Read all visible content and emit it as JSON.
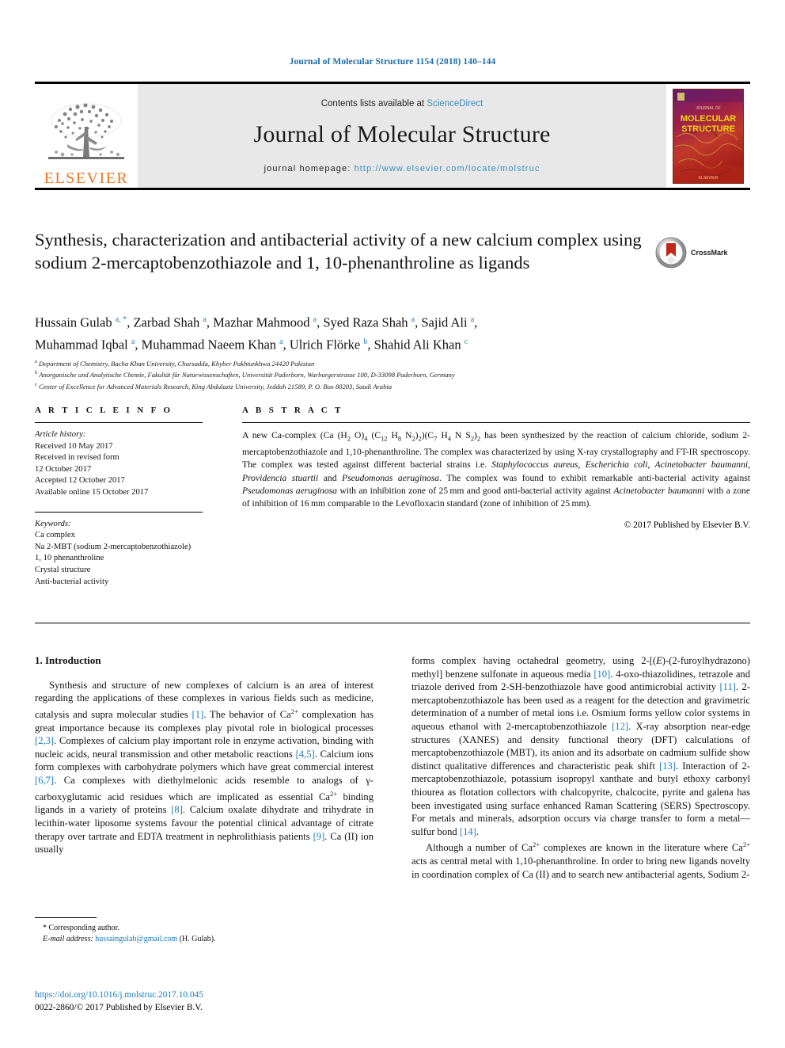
{
  "running_head": "Journal of Molecular Structure 1154 (2018) 140–144",
  "masthead": {
    "contents_prefix": "Contents lists available at ",
    "sciencedirect": "ScienceDirect",
    "journal_name": "Journal of Molecular Structure",
    "homepage_prefix": "journal homepage: ",
    "homepage_url": "http://www.elsevier.com/locate/molstruc",
    "publisher_wordmark": "ELSEVIER",
    "publisher_color": "#E87722",
    "link_color": "#3a8fbf",
    "cover_title_line1": "MOLECULAR",
    "cover_title_line2": "STRUCTURE"
  },
  "crossmark": {
    "label": "CrossMark"
  },
  "article": {
    "title": "Synthesis, characterization and antibacterial activity of a new calcium complex using sodium 2-mercaptobenzothiazole and 1, 10-phenanthroline as ligands",
    "authors_line1": "Hussain Gulab <sup>a, *</sup>, Zarbad Shah <sup>a</sup>, Mazhar Mahmood <sup>a</sup>, Syed Raza Shah <sup>a</sup>, Sajid Ali <sup>a</sup>,",
    "authors_line2": "Muhammad Iqbal <sup>a</sup>, Muhammad Naeem Khan <sup>a</sup>, Ulrich Flörke <sup>b</sup>, Shahid Ali Khan <sup>c</sup>",
    "affiliations": [
      "Department of Chemistry, Bacha Khan University, Charsadda, Khyber Pakhtunkhwa 24420 Pakistan",
      "Anorganische und Analytische Chemie, Fakultät für Naturwissenschaften, Universität Paderborn, Warburgerstrasse 100, D-33098 Paderborn, Germany",
      "Center of Excellence for Advanced Materials Research, King Abdulaziz University, Jeddah 21589, P. O. Box 80203, Saudi Arabia"
    ],
    "affiliation_marks": [
      "a",
      "b",
      "c"
    ]
  },
  "article_info": {
    "heading": "A R T I C L E   I N F O",
    "history_label": "Article history:",
    "history": [
      "Received 10 May 2017",
      "Received in revised form",
      "12 October 2017",
      "Accepted 12 October 2017",
      "Available online 15 October 2017"
    ],
    "keywords_label": "Keywords:",
    "keywords": [
      "Ca complex",
      "Na 2-MBT (sodium 2-mercaptobenzothiazole)",
      "1, 10 phenanthroline",
      "Crystal structure",
      "Anti-bacterial activity"
    ]
  },
  "abstract": {
    "heading": "A B S T R A C T",
    "html": "A new Ca-complex (Ca (H<sub>2</sub> O)<sub>4</sub> (C<sub>12</sub> H<sub>8</sub> N<sub>2</sub>)<sub>2</sub>)(C<sub>7</sub> H<sub>4</sub> N S<sub>2</sub>)<sub>2</sub> has been synthesized by the reaction of calcium chloride, sodium 2-mercaptobenzothiazole and 1,10-phenanthroline. The complex was characterized by using X-ray crystallography and FT-IR spectroscopy. The complex was tested against different bacterial strains i.e. <i>Staphylococcus aureus</i>, <i>Escherichia coli</i>, <i>Acinetobacter baumanni</i>, <i>Providencia stuartii</i> and <i>Pseudomonas aeruginosa</i>. The complex was found to exhibit remarkable anti-bacterial activity against <i>Pseudomonas aeruginosa</i> with an inhibition zone of 25&#8201;mm and good anti-bacterial activity against <i>Acinetobacter baumanni</i> with a zone of inhibition of 16&#8201;mm comparable to the Levofloxacin standard (zone of inhibition of 25&#8201;mm).",
    "copyright": "© 2017 Published by Elsevier B.V."
  },
  "body": {
    "section_number_title": "1. Introduction",
    "left_html": "Synthesis and structure of new complexes of calcium is an area of interest regarding the applications of these complexes in various fields such as medicine, catalysis and supra molecular studies <span class=\"ref\">[1]</span>. The behavior of Ca<sup>2+</sup> complexation has great importance because its complexes play pivotal role in biological processes <span class=\"ref\">[2,3]</span>. Complexes of calcium play important role in enzyme activation, binding with nucleic acids, neural transmission and other metabolic reactions <span class=\"ref\">[4,5]</span>. Calcium ions form complexes with carbohydrate polymers which have great commercial interest <span class=\"ref\">[6,7]</span>. Ca complexes with diethylmelonic acids resemble to analogs of γ-carboxyglutamic acid residues which are implicated as essential Ca<sup>2+</sup> binding ligands in a variety of proteins <span class=\"ref\">[8]</span>. Calcium oxalate dihydrate and trihydrate in lecithin-water liposome systems favour the potential clinical advantage of citrate therapy over tartrate and EDTA treatment in nephrolithiasis patients <span class=\"ref\">[9]</span>. Ca (II) ion usually",
    "right_html_p1": "forms complex having octahedral geometry, using 2-[(<i>E</i>)-(2-furoylhydrazono) methyl] benzene sulfonate in aqueous media <span class=\"ref\">[10]</span>. 4-oxo-thiazolidines, tetrazole and triazole derived from 2-SH-benzothiazole have good antimicrobial activity <span class=\"ref\">[11]</span>. 2-mercaptobenzothiazole has been used as a reagent for the detection and gravimetric determination of a number of metal ions i.e. Osmium forms yellow color systems in aqueous ethanol with 2-mercaptobenzothiazole <span class=\"ref\">[12]</span>. X-ray absorption near-edge structures (XANES) and density functional theory (DFT) calculations of mercaptobenzothiazole (MBT), its anion and its adsorbate on cadmium sulfide show distinct qualitative differences and characteristic peak shift <span class=\"ref\">[13]</span>. Interaction of 2-mercaptobenzothiazole, potassium isopropyl xanthate and butyl ethoxy carbonyl thiourea as flotation collectors with chalcopyrite, chalcocite, pyrite and galena has been investigated using surface enhanced Raman Scattering (SERS) Spectroscopy. For metals and minerals, adsorption occurs via charge transfer to form a metal—sulfur bond <span class=\"ref\">[14]</span>.",
    "right_html_p2": "Although a number of Ca<sup>2+</sup> complexes are known in the literature where Ca<sup>2+</sup> acts as central metal with 1,10-phenanthroline. In order to bring new ligands novelty in coordination complex of Ca (II) and to search new antibacterial agents, Sodium 2-"
  },
  "footnote": {
    "corresponding": "* Corresponding author.",
    "email_label": "E-mail address: ",
    "email": "hussaingulab@gmail.com",
    "email_suffix": " (H. Gulab)."
  },
  "footer": {
    "doi": "https://doi.org/10.1016/j.molstruc.2017.10.045",
    "issn_line": "0022-2860/© 2017 Published by Elsevier B.V."
  }
}
